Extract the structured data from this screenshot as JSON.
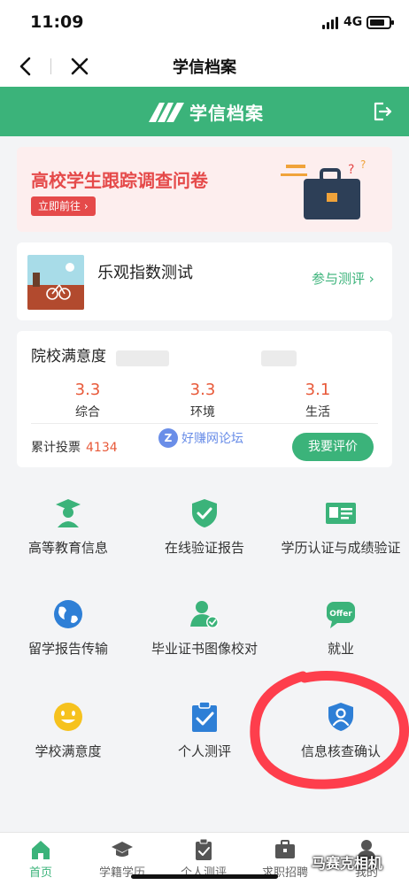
{
  "status_bar": {
    "time": "11:09",
    "network": "4G"
  },
  "nav": {
    "title": "学信档案"
  },
  "app_header": {
    "title": "学信档案"
  },
  "banner": {
    "title": "高校学生跟踪调查问卷",
    "button": "立即前往 ›"
  },
  "quiz": {
    "title": "乐观指数测试",
    "link": "参与测评 ›"
  },
  "satisfaction": {
    "title": "院校满意度",
    "metrics": [
      {
        "value": "3.3",
        "label": "综合"
      },
      {
        "value": "3.3",
        "label": "环境"
      },
      {
        "value": "3.1",
        "label": "生活"
      }
    ],
    "votes_label": "累计投票",
    "votes_count": "4134",
    "watermark_badge": "Z",
    "watermark": "好赚网论坛",
    "rate_button": "我要评价"
  },
  "grid": [
    {
      "label": "高等教育信息",
      "icon": "graduate-icon"
    },
    {
      "label": "在线验证报告",
      "icon": "shield-check-icon"
    },
    {
      "label": "学历认证与成绩验证",
      "icon": "id-card-icon"
    },
    {
      "label": "留学报告传输",
      "icon": "globe-icon"
    },
    {
      "label": "毕业证书图像校对",
      "icon": "user-check-icon"
    },
    {
      "label": "就业",
      "icon": "offer-icon"
    },
    {
      "label": "学校满意度",
      "icon": "smiley-icon"
    },
    {
      "label": "个人测评",
      "icon": "clipboard-check-icon"
    },
    {
      "label": "信息核查确认",
      "icon": "user-shield-icon"
    }
  ],
  "offer_text": "Offer",
  "tabs": [
    {
      "label": "首页",
      "active": true
    },
    {
      "label": "学籍学历",
      "active": false
    },
    {
      "label": "个人测评",
      "active": false
    },
    {
      "label": "求职招聘",
      "active": false
    },
    {
      "label": "我的",
      "active": false
    }
  ],
  "corner_watermark": "马赛克相机",
  "colors": {
    "primary": "#3bb37a",
    "accent_red": "#e54a4a",
    "score": "#e85a3a",
    "annotation": "#ff2a3a"
  }
}
